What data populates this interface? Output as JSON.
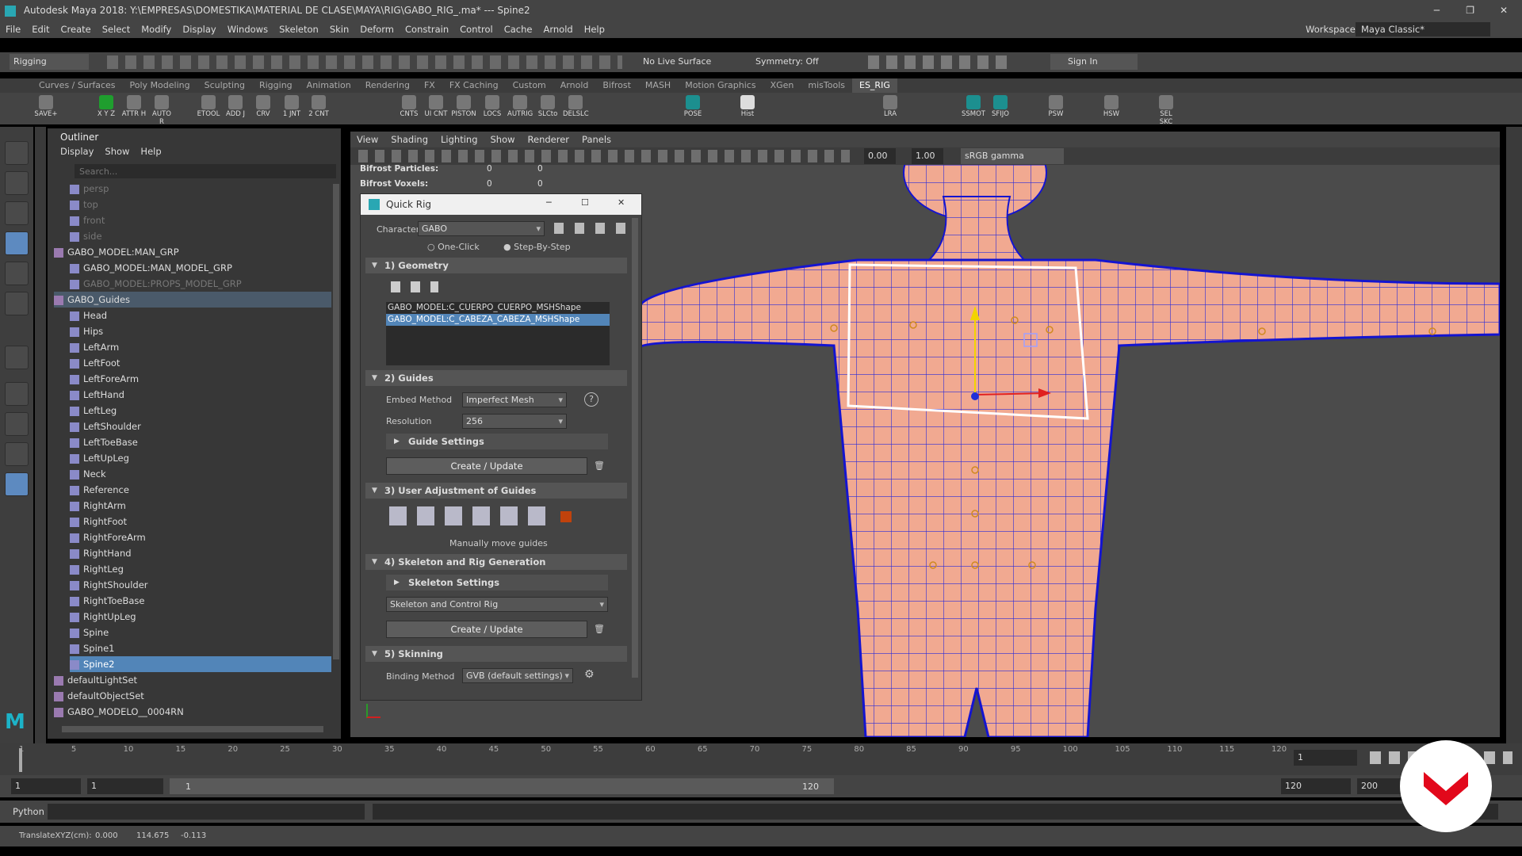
{
  "window": {
    "title": "Autodesk Maya 2018: Y:\\EMPRESAS\\DOMESTIKA\\MATERIAL DE CLASE\\MAYA\\RIG\\GABO_RIG_.ma*  ---  Spine2"
  },
  "menu": [
    "File",
    "Edit",
    "Create",
    "Select",
    "Modify",
    "Display",
    "Windows",
    "Skeleton",
    "Skin",
    "Deform",
    "Constrain",
    "Control",
    "Cache",
    "Arnold",
    "Help"
  ],
  "workspace": {
    "label": "Workspace :",
    "value": "Maya Classic*"
  },
  "status": {
    "menuset": "Rigging",
    "live_surface": "No Live Surface",
    "symmetry": "Symmetry: Off",
    "sign_in": "Sign In"
  },
  "shelf_tabs": [
    "Curves / Surfaces",
    "Poly Modeling",
    "Sculpting",
    "Rigging",
    "Animation",
    "Rendering",
    "FX",
    "FX Caching",
    "Custom",
    "Arnold",
    "Bifrost",
    "MASH",
    "Motion Graphics",
    "XGen",
    "misTools",
    "ES_RIG"
  ],
  "shelf_active": "ES_RIG",
  "shelf_items": [
    "SAVE+",
    "X Y Z",
    "ATTR H",
    "AUTO R",
    "ETOOL",
    "ADD J",
    "CRV",
    "1 JNT",
    "2 CNT",
    "CNTS",
    "UI CNT",
    "PISTON",
    "LOCS",
    "AUTRIG",
    "SLCto",
    "DELSLC",
    "POSE",
    "Hist",
    "LRA",
    "SSMOT",
    "SFIJO",
    "PSW",
    "HSW",
    "SEL SKC"
  ],
  "outliner": {
    "title": "Outliner",
    "menu": [
      "Display",
      "Show",
      "Help"
    ],
    "search_placeholder": "Search...",
    "rows": [
      {
        "label": "persp",
        "indent": 1,
        "dim": true
      },
      {
        "label": "top",
        "indent": 1,
        "dim": true
      },
      {
        "label": "front",
        "indent": 1,
        "dim": true
      },
      {
        "label": "side",
        "indent": 1,
        "dim": true
      },
      {
        "label": "GABO_MODEL:MAN_GRP",
        "indent": 0
      },
      {
        "label": "GABO_MODEL:MAN_MODEL_GRP",
        "indent": 1
      },
      {
        "label": "GABO_MODEL:PROPS_MODEL_GRP",
        "indent": 1,
        "dim": true
      },
      {
        "label": "GABO_Guides",
        "indent": 0,
        "hl": true
      },
      {
        "label": "Head",
        "indent": 1
      },
      {
        "label": "Hips",
        "indent": 1
      },
      {
        "label": "LeftArm",
        "indent": 1
      },
      {
        "label": "LeftFoot",
        "indent": 1
      },
      {
        "label": "LeftForeArm",
        "indent": 1
      },
      {
        "label": "LeftHand",
        "indent": 1
      },
      {
        "label": "LeftLeg",
        "indent": 1
      },
      {
        "label": "LeftShoulder",
        "indent": 1
      },
      {
        "label": "LeftToeBase",
        "indent": 1
      },
      {
        "label": "LeftUpLeg",
        "indent": 1
      },
      {
        "label": "Neck",
        "indent": 1
      },
      {
        "label": "Reference",
        "indent": 1
      },
      {
        "label": "RightArm",
        "indent": 1
      },
      {
        "label": "RightFoot",
        "indent": 1
      },
      {
        "label": "RightForeArm",
        "indent": 1
      },
      {
        "label": "RightHand",
        "indent": 1
      },
      {
        "label": "RightLeg",
        "indent": 1
      },
      {
        "label": "RightShoulder",
        "indent": 1
      },
      {
        "label": "RightToeBase",
        "indent": 1
      },
      {
        "label": "RightUpLeg",
        "indent": 1
      },
      {
        "label": "Spine",
        "indent": 1
      },
      {
        "label": "Spine1",
        "indent": 1
      },
      {
        "label": "Spine2",
        "indent": 1,
        "sel": true
      },
      {
        "label": "defaultLightSet",
        "indent": 0
      },
      {
        "label": "defaultObjectSet",
        "indent": 0
      },
      {
        "label": "GABO_MODELO__0004RN",
        "indent": 0
      }
    ]
  },
  "panel_menu": [
    "View",
    "Shading",
    "Lighting",
    "Show",
    "Renderer",
    "Panels"
  ],
  "panel_values": {
    "v1": "0.00",
    "v2": "1.00",
    "colorspace": "sRGB gamma"
  },
  "hud": [
    {
      "label": "Bifrost Particles:",
      "a": "0",
      "b": "0"
    },
    {
      "label": "Bifrost Voxels:",
      "a": "0",
      "b": "0"
    }
  ],
  "quick_rig": {
    "title": "Quick Rig",
    "character_label": "Character:",
    "character": "GABO",
    "mode_one": "One-Click",
    "mode_step": "Step-By-Step",
    "s1": "1) Geometry",
    "geo_items": [
      "GABO_MODEL:C_CUERPO_CUERPO_MSHShape",
      "GABO_MODEL:C_CABEZA_CABEZA_MSHShape"
    ],
    "s2": "2) Guides",
    "embed_label": "Embed Method",
    "embed": "Imperfect Mesh",
    "res_label": "Resolution",
    "res": "256",
    "guide_settings": "Guide Settings",
    "create_update": "Create / Update",
    "s3": "3) User Adjustment of Guides",
    "manual": "Manually move guides",
    "s4": "4) Skeleton and Rig Generation",
    "skel_settings": "Skeleton Settings",
    "skel_combo": "Skeleton and Control Rig",
    "s5": "5) Skinning",
    "bind_label": "Binding Method",
    "bind": "GVB (default settings)"
  },
  "timeline": {
    "ticks": [
      "1",
      "5",
      "10",
      "15",
      "20",
      "25",
      "30",
      "35",
      "40",
      "45",
      "50",
      "55",
      "60",
      "65",
      "70",
      "75",
      "80",
      "85",
      "90",
      "95",
      "100",
      "105",
      "110",
      "115",
      "120"
    ],
    "current": "1"
  },
  "range": {
    "start": "1",
    "start2": "1",
    "slider_start": "1",
    "slider_end": "120",
    "end": "120",
    "end2": "200"
  },
  "cmd": {
    "label": "Python"
  },
  "help": {
    "label": "TranslateXYZ(cm):",
    "x": "0.000",
    "y": "114.675",
    "z": "-0.113"
  }
}
